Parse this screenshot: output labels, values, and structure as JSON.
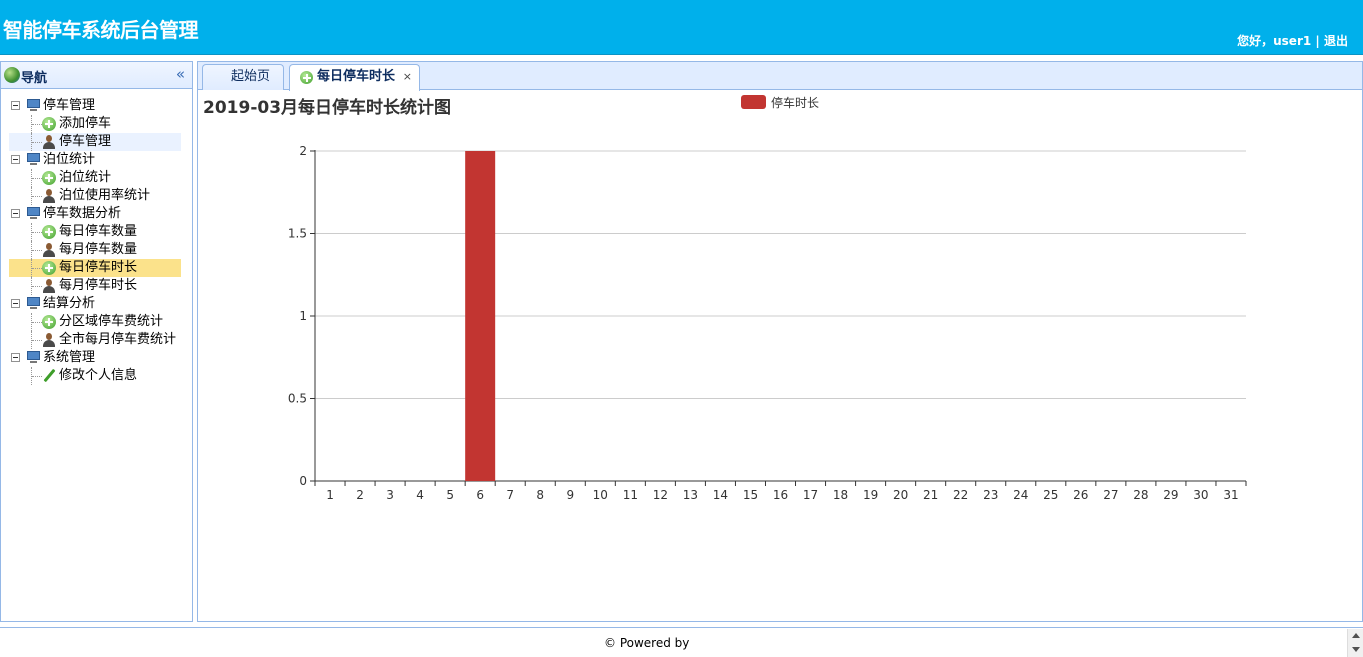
{
  "header": {
    "title": "智能停车系统后台管理",
    "greeting": "您好，user1",
    "separator": "|",
    "logout": "退出"
  },
  "sidebar": {
    "title": "导航",
    "collapse_icon": "«",
    "groups": [
      {
        "label": "停车管理",
        "items": [
          {
            "label": "添加停车",
            "icon": "add-icon"
          },
          {
            "label": "停车管理",
            "icon": "user-icon"
          }
        ]
      },
      {
        "label": "泊位统计",
        "items": [
          {
            "label": "泊位统计",
            "icon": "add-icon"
          },
          {
            "label": "泊位使用率统计",
            "icon": "user-icon"
          }
        ]
      },
      {
        "label": "停车数据分析",
        "items": [
          {
            "label": "每日停车数量",
            "icon": "add-icon"
          },
          {
            "label": "每月停车数量",
            "icon": "user-icon"
          },
          {
            "label": "每日停车时长",
            "icon": "add-icon"
          },
          {
            "label": "每月停车时长",
            "icon": "user-icon"
          }
        ]
      },
      {
        "label": "结算分析",
        "items": [
          {
            "label": "分区域停车费统计",
            "icon": "add-icon"
          },
          {
            "label": "全市每月停车费统计",
            "icon": "user-icon"
          }
        ]
      },
      {
        "label": "系统管理",
        "items": [
          {
            "label": "修改个人信息",
            "icon": "edit-icon"
          }
        ]
      }
    ]
  },
  "tabs": [
    {
      "label": "起始页"
    },
    {
      "label": "每日停车时长",
      "close": "×"
    }
  ],
  "chart_data": {
    "type": "bar",
    "title": "2019-03月每日停车时长统计图",
    "legend": [
      "停车时长"
    ],
    "legend_position": "top-center",
    "color": "#c23531",
    "categories": [
      "1",
      "2",
      "3",
      "4",
      "5",
      "6",
      "7",
      "8",
      "9",
      "10",
      "11",
      "12",
      "13",
      "14",
      "15",
      "16",
      "17",
      "18",
      "19",
      "20",
      "21",
      "22",
      "23",
      "24",
      "25",
      "26",
      "27",
      "28",
      "29",
      "30",
      "31"
    ],
    "series": [
      {
        "name": "停车时长",
        "values": [
          0,
          0,
          0,
          0,
          0,
          2,
          0,
          0,
          0,
          0,
          0,
          0,
          0,
          0,
          0,
          0,
          0,
          0,
          0,
          0,
          0,
          0,
          0,
          0,
          0,
          0,
          0,
          0,
          0,
          0,
          0
        ]
      }
    ],
    "yticks": [
      "0",
      "0.5",
      "1",
      "1.5",
      "2"
    ],
    "ylim": [
      0,
      2
    ],
    "grid": true
  },
  "footer": {
    "powered": "© Powered by"
  }
}
